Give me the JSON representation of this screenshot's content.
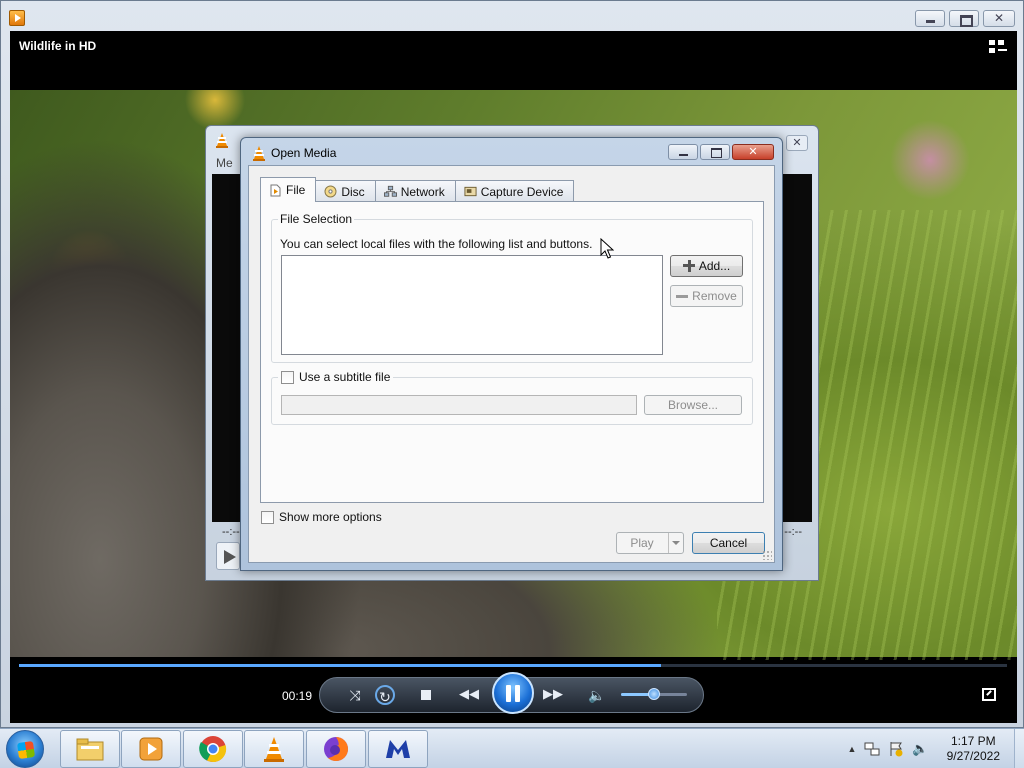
{
  "wmp": {
    "title": "Wildlife in HD",
    "time_elapsed": "00:19",
    "seek_progress": 0.65,
    "volume_level": 0.5
  },
  "vlc_back": {
    "menu_label": "Me",
    "time_left": "--:--",
    "time_right": "--:--"
  },
  "dialog": {
    "title": "Open Media",
    "tabs": [
      {
        "label": "File",
        "icon": "file-icon",
        "active": true
      },
      {
        "label": "Disc",
        "icon": "disc-icon",
        "active": false
      },
      {
        "label": "Network",
        "icon": "network-icon",
        "active": false
      },
      {
        "label": "Capture Device",
        "icon": "capture-device-icon",
        "active": false
      }
    ],
    "file_selection": {
      "title": "File Selection",
      "hint": "You can select local files with the following list and buttons.",
      "add_label": "Add...",
      "remove_label": "Remove"
    },
    "subtitle": {
      "checkbox_label": "Use a subtitle file",
      "checked": false,
      "browse_label": "Browse..."
    },
    "show_more_options": "Show more options",
    "play_label": "Play",
    "cancel_label": "Cancel"
  },
  "taskbar": {
    "apps": [
      "file-explorer-icon",
      "windows-media-player-icon",
      "chrome-icon",
      "vlc-icon",
      "firefox-icon",
      "malwarebytes-icon"
    ],
    "clock_time": "1:17 PM",
    "clock_date": "9/27/2022"
  },
  "colors": {
    "accent_blue": "#1b6fd6",
    "vlc_orange": "#f08a00",
    "dialog_close_red": "#c7402a"
  }
}
